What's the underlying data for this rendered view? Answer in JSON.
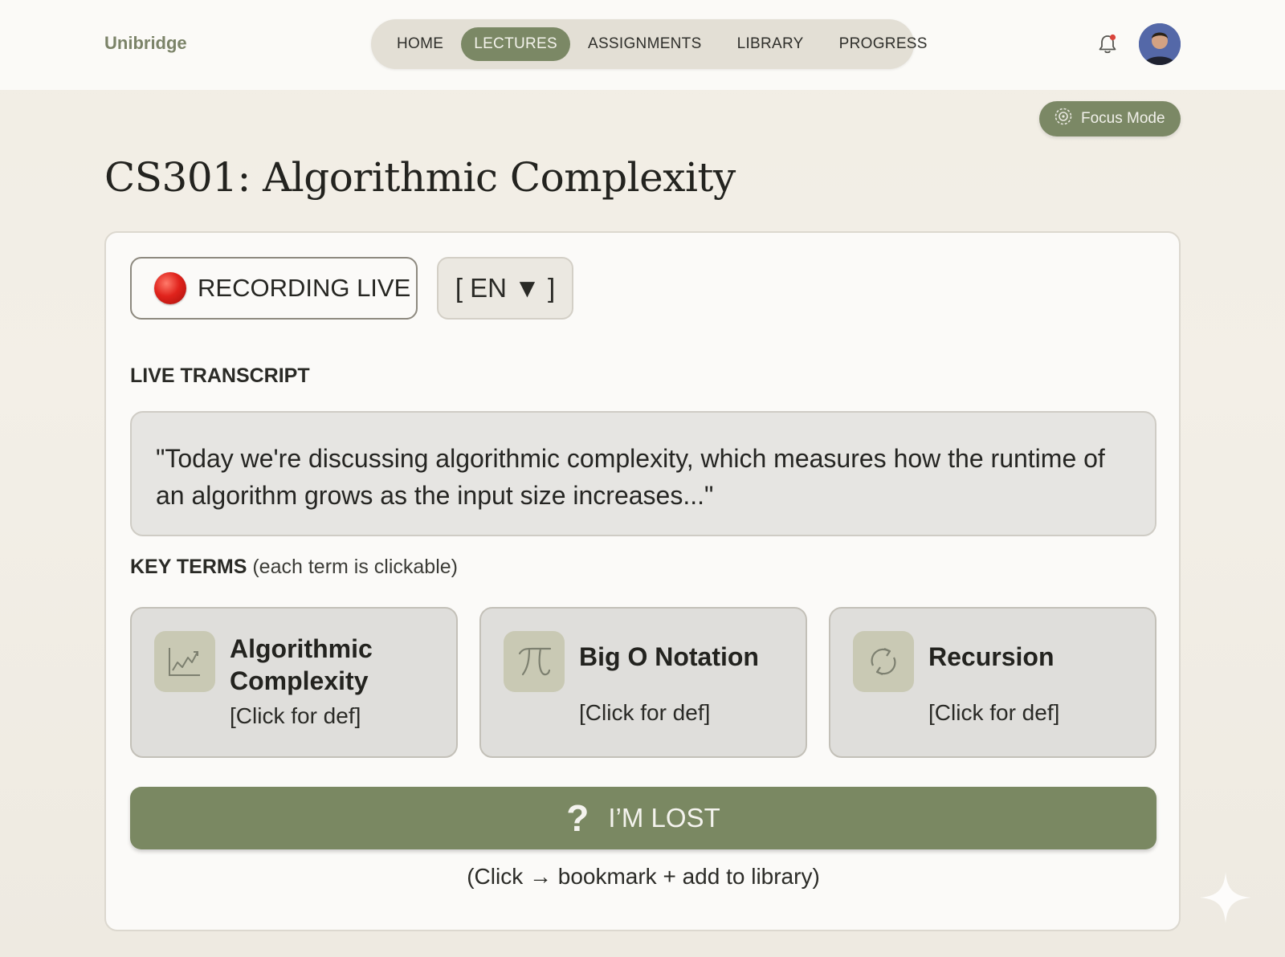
{
  "brand": "Unibridge",
  "nav": {
    "items": [
      {
        "label": "HOME",
        "active": false
      },
      {
        "label": "LECTURES",
        "active": true
      },
      {
        "label": "ASSIGNMENTS",
        "active": false
      },
      {
        "label": "LIBRARY",
        "active": false
      },
      {
        "label": "PROGRESS",
        "active": false
      }
    ]
  },
  "header": {
    "bell_icon": "bell-icon",
    "avatar": "user-avatar"
  },
  "focus_mode": {
    "label": "Focus Mode",
    "icon": "focus-target-icon"
  },
  "page_title": "CS301: Algorithmic Complexity",
  "recording": {
    "label": "RECORDING LIVE",
    "icon": "record-dot-icon",
    "color": "#e0231c"
  },
  "language": {
    "label": "[ EN ▼ ]"
  },
  "transcript": {
    "heading": "LIVE TRANSCRIPT",
    "text": "\"Today we're discussing algorithmic complexity, which measures how the runtime of an algorithm grows as the input size increases...\""
  },
  "key_terms": {
    "heading": "KEY TERMS",
    "subheading": "(each term is clickable)",
    "items": [
      {
        "name": "Algorithmic Complexity",
        "def": "[Click for def]",
        "icon": "chart-trend-icon"
      },
      {
        "name": "Big O Notation",
        "def": "[Click for def]",
        "icon": "pi-icon"
      },
      {
        "name": "Recursion",
        "def": "[Click for def]",
        "icon": "cycle-arrows-icon"
      }
    ]
  },
  "lost_button": {
    "icon": "?",
    "label": "I’M LOST"
  },
  "lost_hint": "(Click → bookmark + add to library)",
  "colors": {
    "accent": "#7b8865",
    "background": "#f1ede4",
    "record": "#e0231c"
  }
}
